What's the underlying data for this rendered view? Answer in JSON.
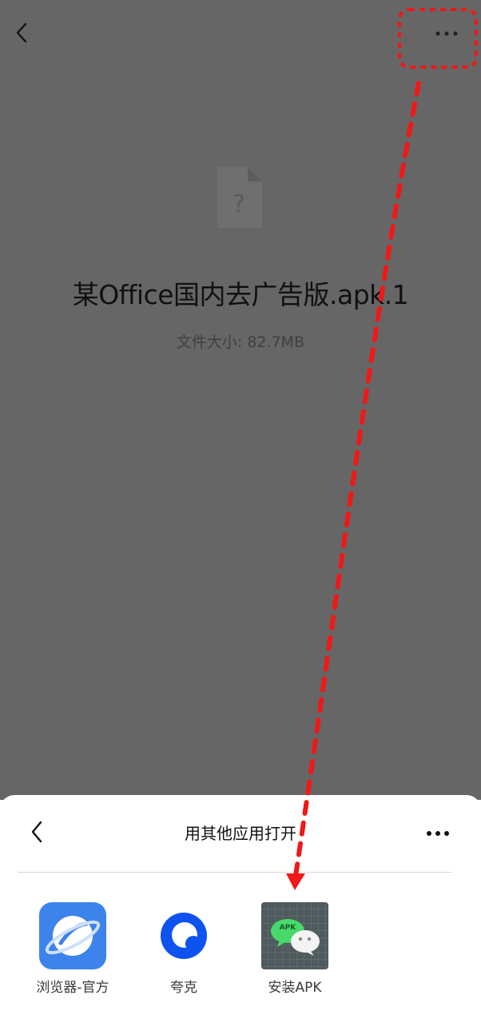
{
  "header": {
    "back_icon": "chevron-left-icon",
    "more_icon": "more-horizontal-icon"
  },
  "file": {
    "icon": "unknown-file-icon",
    "icon_glyph": "?",
    "name": "某Office国内去广告版.apk.1",
    "size_text": "文件大小: 82.7MB"
  },
  "sheet": {
    "title": "用其他应用打开",
    "back_icon": "chevron-left-icon",
    "more_icon": "more-horizontal-icon",
    "apps": [
      {
        "label": "浏览器-官方",
        "icon": "browser-planet-icon",
        "color": "#3d83ec"
      },
      {
        "label": "夸克",
        "icon": "quark-icon",
        "color": "#0e53f0"
      },
      {
        "label": "安装APK",
        "icon": "apk-installer-icon",
        "icon_text": "APK",
        "color": "#4f5a5c"
      }
    ]
  },
  "annotation": {
    "color": "#f01818"
  }
}
